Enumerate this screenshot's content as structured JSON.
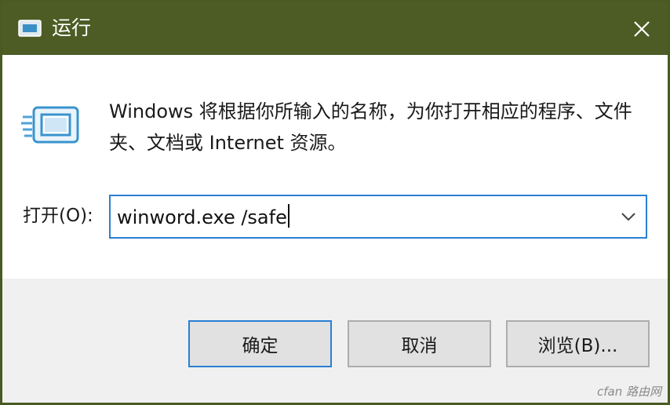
{
  "window": {
    "title": "运行",
    "close_glyph": "✕"
  },
  "content": {
    "description": "Windows 将根据你所输入的名称，为你打开相应的程序、文件夹、文档或 Internet 资源。",
    "icon": "run-dialog-icon"
  },
  "open_field": {
    "label": "打开(O):",
    "value": "winword.exe /safe",
    "dropdown_icon": "chevron-down-icon"
  },
  "buttons": {
    "ok": "确定",
    "cancel": "取消",
    "browse": "浏览(B)..."
  },
  "watermark": "cfan 路由网",
  "colors": {
    "titlebar": "#4c5c24",
    "accent_border": "#2a7fd4",
    "footer_bg": "#f0f0f0",
    "button_bg": "#e1e1e1"
  }
}
